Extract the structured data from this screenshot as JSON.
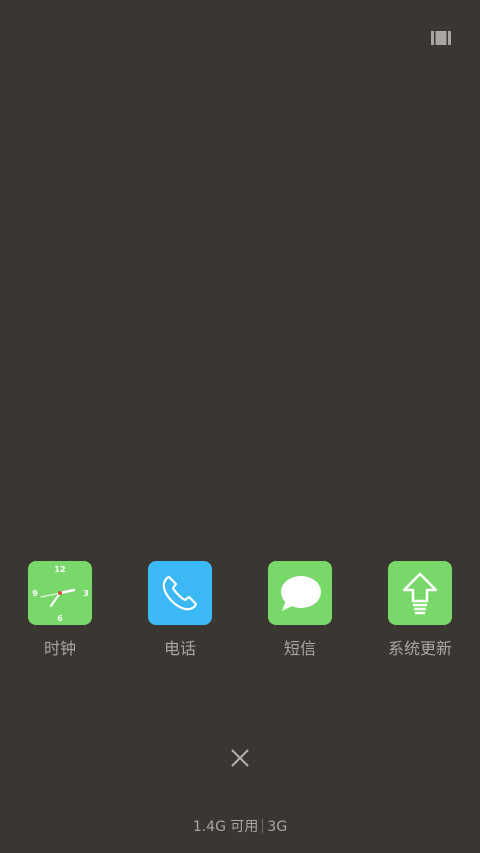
{
  "toolbar": {
    "layout_toggle_icon": "view-toggle-icon"
  },
  "apps": [
    {
      "label": "时钟",
      "icon": "clock-icon",
      "color": "#79d86a",
      "clock_numerals": [
        "12",
        "3",
        "6",
        "9"
      ]
    },
    {
      "label": "电话",
      "icon": "phone-icon",
      "color": "#3cb8f5"
    },
    {
      "label": "短信",
      "icon": "message-icon",
      "color": "#79d86a"
    },
    {
      "label": "系统更新",
      "icon": "update-arrow-icon",
      "color": "#79d86a"
    }
  ],
  "close_icon": "close-icon",
  "memory": {
    "available": "1.4G 可用",
    "total": "3G"
  }
}
